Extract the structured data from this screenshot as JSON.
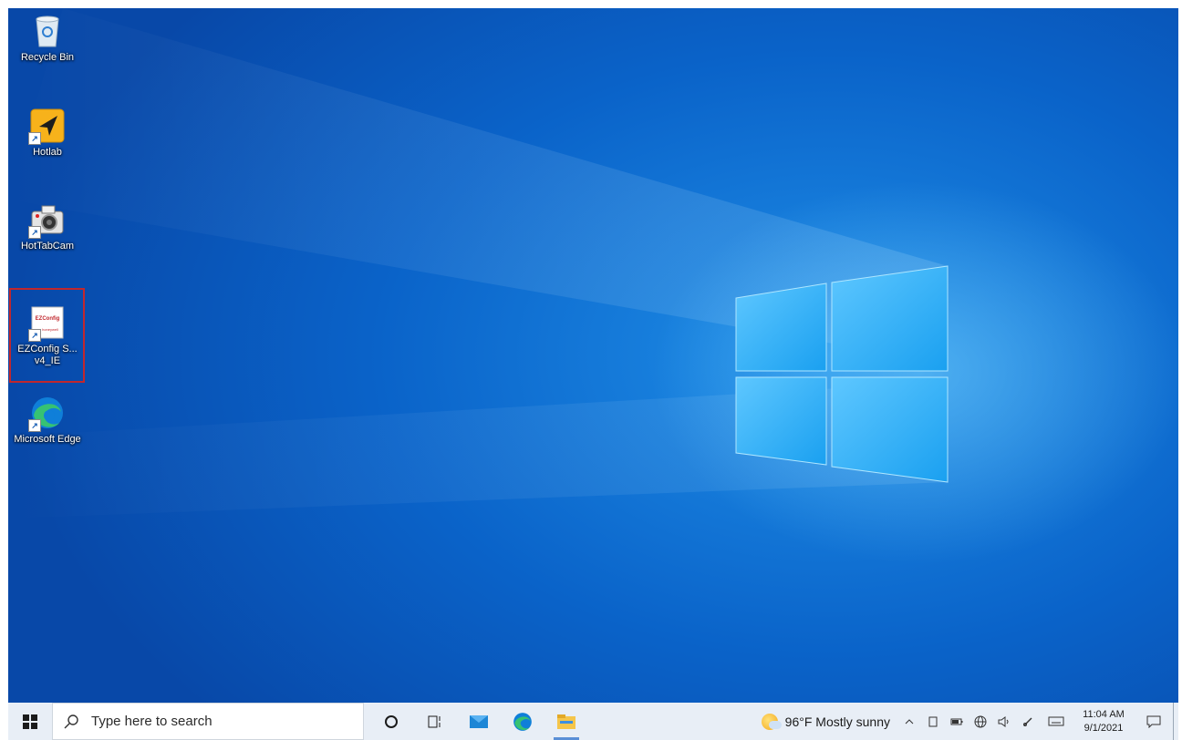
{
  "desktop_icons": [
    {
      "label": "Recycle Bin",
      "icon": "recycle-bin-icon"
    },
    {
      "label": "Hotlab",
      "icon": "hotlab-icon"
    },
    {
      "label": "HotTabCam",
      "icon": "camera-icon"
    },
    {
      "label": "EZConfig S... v4_IE",
      "icon": "ezconfig-icon",
      "icon_text_top": "EZConfig",
      "icon_text_bottom": "honeywell",
      "selected": true
    },
    {
      "label": "Microsoft Edge",
      "icon": "edge-icon"
    }
  ],
  "taskbar": {
    "search_placeholder": "Type here to search",
    "apps": [
      {
        "name": "cortana-icon"
      },
      {
        "name": "task-view-icon"
      },
      {
        "name": "mail-icon"
      },
      {
        "name": "edge-icon"
      },
      {
        "name": "file-explorer-icon",
        "active": true
      }
    ],
    "weather": {
      "temp": "96°F",
      "condition": "Mostly sunny"
    },
    "tray_icons": [
      "chevron-up-icon",
      "tablet-icon",
      "battery-icon",
      "network-icon",
      "volume-icon",
      "pen-icon",
      "keyboard-icon"
    ],
    "clock": {
      "time": "11:04 AM",
      "date": "9/1/2021"
    }
  },
  "colors": {
    "accent": "#0a63c9",
    "selection": "#c1272d",
    "taskbar": "#e8eef6"
  }
}
